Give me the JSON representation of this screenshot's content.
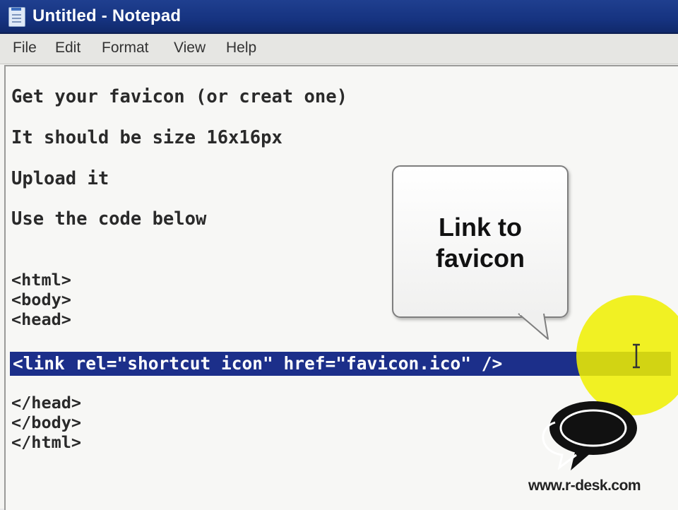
{
  "window": {
    "title": "Untitled - Notepad"
  },
  "menu": [
    "File",
    "Edit",
    "Format",
    "View",
    "Help"
  ],
  "editor": {
    "lines": [
      "Get your favicon (or creat one)",
      "It should be size 16x16px",
      "Upload it",
      "Use the code below"
    ],
    "code_before": [
      "<html>",
      "<body>",
      "<head>"
    ],
    "selected_line": "<link rel=\"shortcut icon\" href=\"favicon.ico\" />",
    "code_after": [
      "</head>",
      "</body>",
      "</html>"
    ]
  },
  "callout": {
    "line1": "Link to",
    "line2": "favicon"
  },
  "watermark": {
    "text": "www.r-desk.com"
  },
  "colors": {
    "titlebar": "#163380",
    "selection": "#1c2f8a",
    "cursor_highlight": "#f0f000"
  }
}
